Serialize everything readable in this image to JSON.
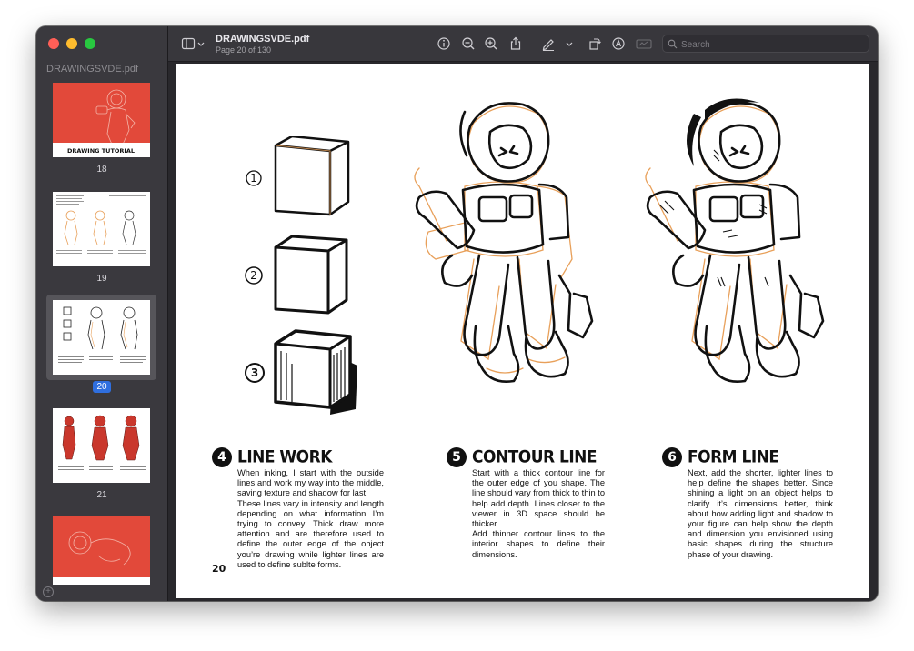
{
  "window": {
    "doc_title": "DRAWINGSVDE.pdf",
    "doc_subtitle": "Page 20 of 130"
  },
  "sidebar": {
    "title": "DRAWINGSVDE.pdf",
    "thumbnails": [
      {
        "page": "18",
        "cover_text": "DRAWING TUTORIAL",
        "kind": "cover"
      },
      {
        "page": "19",
        "kind": "sketch"
      },
      {
        "page": "20",
        "kind": "current",
        "selected": true
      },
      {
        "page": "21",
        "kind": "color"
      },
      {
        "page": "",
        "kind": "cover"
      }
    ]
  },
  "toolbar": {
    "icons": [
      "sidebar-icon",
      "chevron-down-icon",
      "info-icon",
      "zoom-out-icon",
      "zoom-in-icon",
      "share-icon",
      "markup-icon",
      "chevron-down-icon",
      "rotate-icon",
      "annotate-icon",
      "redact-icon"
    ],
    "search_placeholder": "Search"
  },
  "page": {
    "page_number": "20",
    "cube_steps": [
      "1",
      "2",
      "3"
    ],
    "sections": [
      {
        "number": "4",
        "title": "LINE WORK",
        "paragraphs": [
          "When inking, I start with the outside lines and work my way into the middle, saving texture and shadow for last.",
          "These lines vary in intensity and length depending on what information I’m trying to convey. Thick draw more attention and are therefore used to define the outer edge of the object you’re drawing while lighter lines are used to define sublte forms."
        ]
      },
      {
        "number": "5",
        "title": "CONTOUR LINE",
        "paragraphs": [
          "Start with a thick contour line for the outer edge of you shape. The line should vary from thick to thin to help add depth. Lines closer to the viewer in 3D space should be thicker.",
          "Add thinner contour lines to the interior shapes to define their dimensions."
        ]
      },
      {
        "number": "6",
        "title": "FORM LINE",
        "paragraphs": [
          "Next, add the shorter, lighter lines to help define the shapes better. Since shining a light on an object helps to clarify it’s dimensions better, think about how adding light and shadow to your figure can help show the depth and dimension you envisioned using basic shapes during the structure phase of your drawing."
        ]
      }
    ]
  },
  "colors": {
    "sketch_orange": "#e8a05a",
    "cover_red": "#e2493a",
    "selection_blue": "#2f6fdf"
  }
}
